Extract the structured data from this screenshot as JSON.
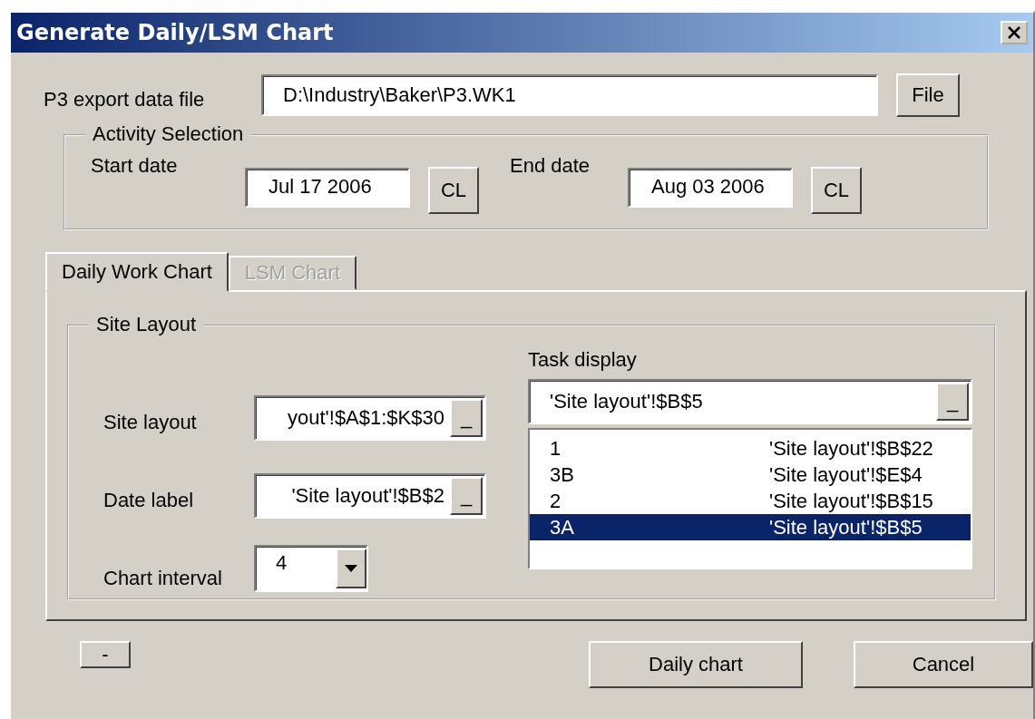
{
  "window": {
    "title": "Generate Daily/LSM Chart"
  },
  "data_file": {
    "label": "P3 export data file",
    "value": "D:\\Industry\\Baker\\P3.WK1",
    "button": "File"
  },
  "activity_selection": {
    "title": "Activity Selection",
    "start": {
      "label": "Start date",
      "value": "Jul 17 2006",
      "button": "CL"
    },
    "end": {
      "label": "End date",
      "value": "Aug 03 2006",
      "button": "CL"
    }
  },
  "tabs": [
    {
      "label": "Daily Work Chart",
      "selected": true,
      "disabled": false
    },
    {
      "label": "LSM Chart",
      "selected": false,
      "disabled": true
    }
  ],
  "site_layout": {
    "title": "Site Layout",
    "fields": [
      {
        "label": "Site layout",
        "value": "yout'!$A$1:$K$30",
        "button": "_"
      },
      {
        "label": "Date label",
        "value": "'Site layout'!$B$2",
        "button": "_"
      }
    ],
    "chart_interval": {
      "label": "Chart interval",
      "value": "4"
    },
    "task_display": {
      "label": "Task display",
      "value": "'Site layout'!$B$5",
      "button": "_",
      "items": [
        {
          "name": "1",
          "ref": "'Site layout'!$B$22",
          "selected": false
        },
        {
          "name": "3B",
          "ref": "'Site layout'!$E$4",
          "selected": false
        },
        {
          "name": "2",
          "ref": "'Site layout'!$B$15",
          "selected": false
        },
        {
          "name": "3A",
          "ref": "'Site layout'!$B$5",
          "selected": true
        }
      ]
    }
  },
  "buttons": {
    "small": "-",
    "primary": "Daily chart",
    "cancel": "Cancel"
  }
}
